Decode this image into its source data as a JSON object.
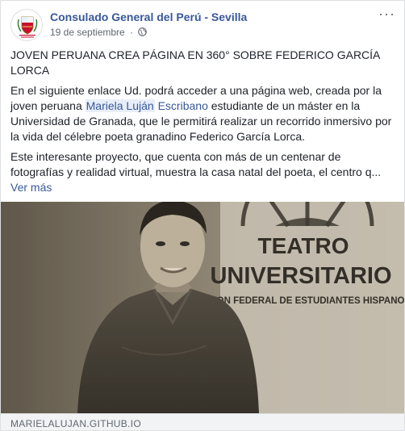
{
  "post": {
    "page_name": "Consulado General del Perú - Sevilla",
    "timestamp": "19 de septiembre",
    "separator": "·",
    "more_icon": "ellipsis-icon",
    "privacy_icon": "globe-icon",
    "headline": "JOVEN PERUANA CREA PÁGINA EN 360° SOBRE FEDERICO GARCÍA LORCA",
    "paragraph1": {
      "before": "En el siguiente enlace Ud. podrá acceder a una página web, creada por la joven peruana ",
      "tag1": "Mariela Luján",
      "space": " ",
      "tag2": "Escribano",
      "after": " estudiante de un máster en la Universidad de Granada, que le permitirá realizar un recorrido inmersivo por la vida del célebre poeta granadino Federico García Lorca."
    },
    "paragraph2": "Este interesante proyecto, que cuenta con más de un centenar de fotografías y realidad virtual, muestra la casa natal del poeta, el centro q...",
    "see_more": "Ver más",
    "link_domain": "MARIELALUJAN.GITHUB.IO"
  },
  "photo": {
    "sign_line1": "TEATRO",
    "sign_line2": "UNIVERSITARIO",
    "sign_line3": "UNION FEDERAL DE ESTUDIANTES HISPANOS"
  }
}
